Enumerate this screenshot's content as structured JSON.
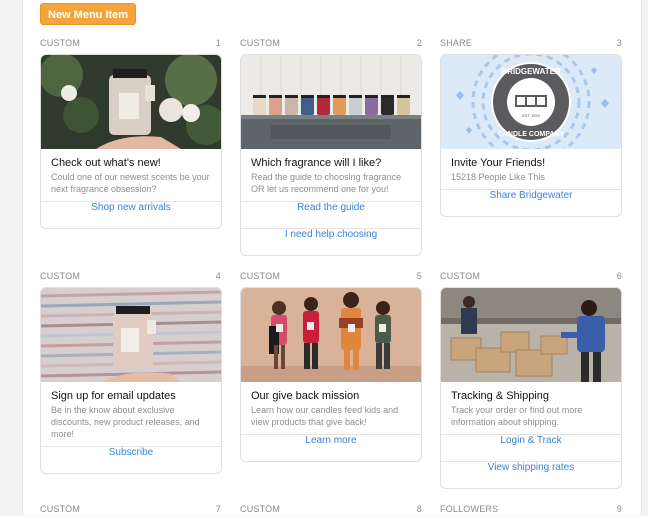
{
  "toolbar": {
    "new_button": "New Menu Item"
  },
  "cards": [
    {
      "type": "CUSTOM",
      "number": "1",
      "title": "Check out what's new!",
      "description": "Could one of our newest scents be your next fragrance obsession?",
      "actions": [
        "Shop new arrivals"
      ]
    },
    {
      "type": "CUSTOM",
      "number": "2",
      "title": "Which fragrance will I like?",
      "description": "Read the guide to choosing fragrance OR let us recommend one for you!",
      "actions": [
        "Read the guide",
        "I need help choosing"
      ]
    },
    {
      "type": "SHARE",
      "number": "3",
      "title": "Invite Your Friends!",
      "description": "15218 People Like This",
      "actions": [
        "Share Bridgewater"
      ],
      "logo": {
        "top": "BRIDGEWATER",
        "middle": "EST 1999",
        "bottom": "CANDLE COMPANY"
      }
    },
    {
      "type": "CUSTOM",
      "number": "4",
      "title": "Sign up for email updates",
      "description": "Be in the know about exclusive discounts, new product releases, and more!",
      "actions": [
        "Subscribe"
      ]
    },
    {
      "type": "CUSTOM",
      "number": "5",
      "title": "Our give back mission",
      "description": "Learn how our candles feed kids and view products that give back!",
      "actions": [
        "Learn more"
      ]
    },
    {
      "type": "CUSTOM",
      "number": "6",
      "title": "Tracking & Shipping",
      "description": "Track your order or find out more information about shipping.",
      "actions": [
        "Login & Track",
        "View shipping rates"
      ]
    },
    {
      "type": "CUSTOM",
      "number": "7"
    },
    {
      "type": "CUSTOM",
      "number": "8"
    },
    {
      "type": "FOLLOWERS",
      "number": "9"
    }
  ],
  "colors": {
    "accent": "#f5a33b",
    "link": "#3b82d6",
    "logo": "#5a5a5f",
    "share_bg": "#dce9f7"
  }
}
